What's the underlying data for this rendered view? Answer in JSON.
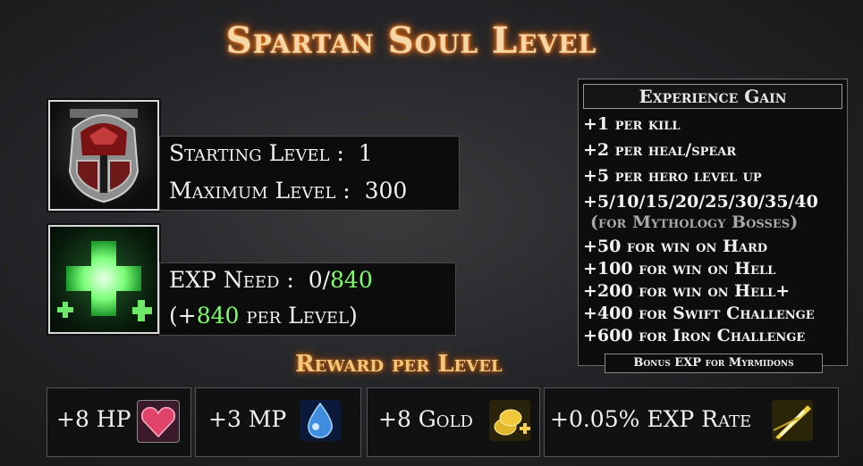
{
  "title": "Spartan Soul Level",
  "level_info": {
    "starting_label": "Starting Level :",
    "starting_value": "1",
    "maximum_label": "Maximum Level :",
    "maximum_value": "300"
  },
  "exp_info": {
    "need_label": "EXP Need :",
    "need_current": "0/",
    "need_total": "840",
    "per_level_prefix": "(+",
    "per_level_value": "840",
    "per_level_suffix": " per Level)"
  },
  "reward": {
    "title": "Reward per Level",
    "items": [
      {
        "label": "+8 HP",
        "icon": "heart-icon",
        "color": "#e0436a"
      },
      {
        "label": "+3 MP",
        "icon": "water-drop-icon",
        "color": "#3f8de0"
      },
      {
        "label": "+8 Gold",
        "icon": "gold-coins-icon",
        "color": "#e0b52a"
      },
      {
        "label": "+0.05% EXP Rate",
        "icon": "golden-spear-icon",
        "color": "#f0d23a"
      }
    ]
  },
  "experience_gain": {
    "title": "Experience Gain",
    "lines": [
      "+1 per kill",
      "+2 per heal/spear",
      "+5 per hero level up",
      "+5/10/15/20/25/30/35/40",
      "(for Mythology Bosses)",
      "+50 for win on Hard",
      "+100 for win on Hell",
      "+200 for win on Hell+",
      "+400 for Swift Challenge",
      "+600 for Iron Challenge"
    ],
    "bonus": "Bonus EXP for Myrmidons"
  },
  "colors": {
    "title_glow": "#ff7a1a",
    "green": "#7dff6a",
    "reward_title": "#f1c77a"
  },
  "icons": {
    "portrait": "spartan-helmet-icon",
    "exp": "green-cross-icon"
  }
}
